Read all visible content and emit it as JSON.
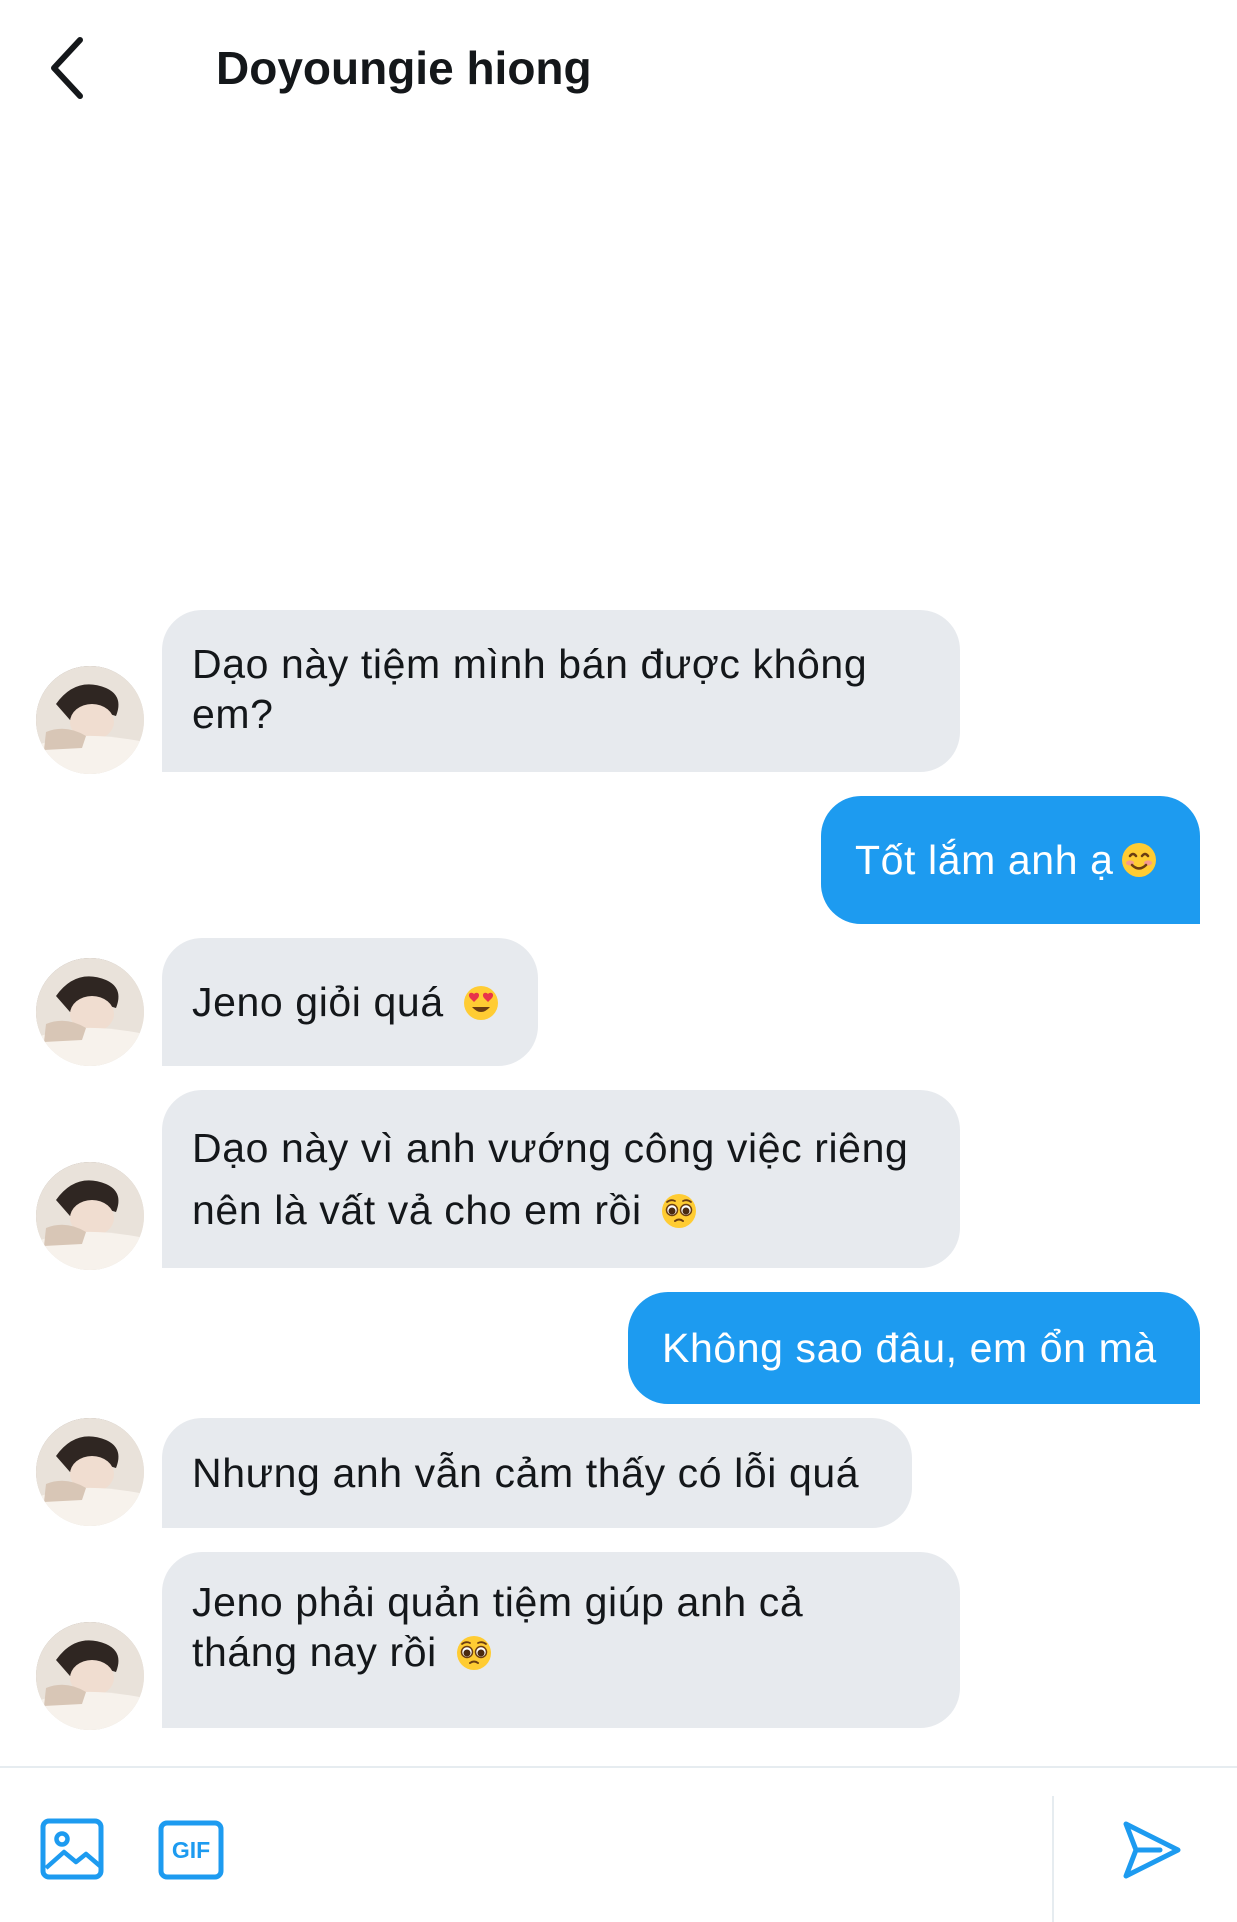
{
  "header": {
    "title": "Doyoungie hiong"
  },
  "messages": [
    {
      "dir": "in",
      "text": "Dạo này tiệm mình bán được không em?",
      "emoji": ""
    },
    {
      "dir": "out",
      "text": "Tốt lắm anh ạ",
      "emoji": "smiling-face-emoji"
    },
    {
      "dir": "in",
      "text": "Jeno giỏi quá",
      "emoji": "heart-eyes-emoji"
    },
    {
      "dir": "in",
      "text": "Dạo này vì anh vướng công việc riêng nên là vất vả cho em rồi",
      "emoji": "pleading-face-emoji"
    },
    {
      "dir": "out",
      "text": "Không sao đâu, em ổn mà",
      "emoji": ""
    },
    {
      "dir": "in",
      "text": "Nhưng anh vẫn cảm thấy có lỗi quá",
      "emoji": ""
    },
    {
      "dir": "in",
      "text": "Jeno phải quản tiệm giúp anh cả tháng nay rồi",
      "emoji": "pleading-face-emoji"
    }
  ],
  "composer": {
    "gif_label": "GIF",
    "icons": [
      "image-icon",
      "gif-icon",
      "send-icon"
    ]
  },
  "colors": {
    "accent": "#1d9bf0",
    "incoming_bubble": "#e7eaee",
    "text": "#14171a"
  }
}
